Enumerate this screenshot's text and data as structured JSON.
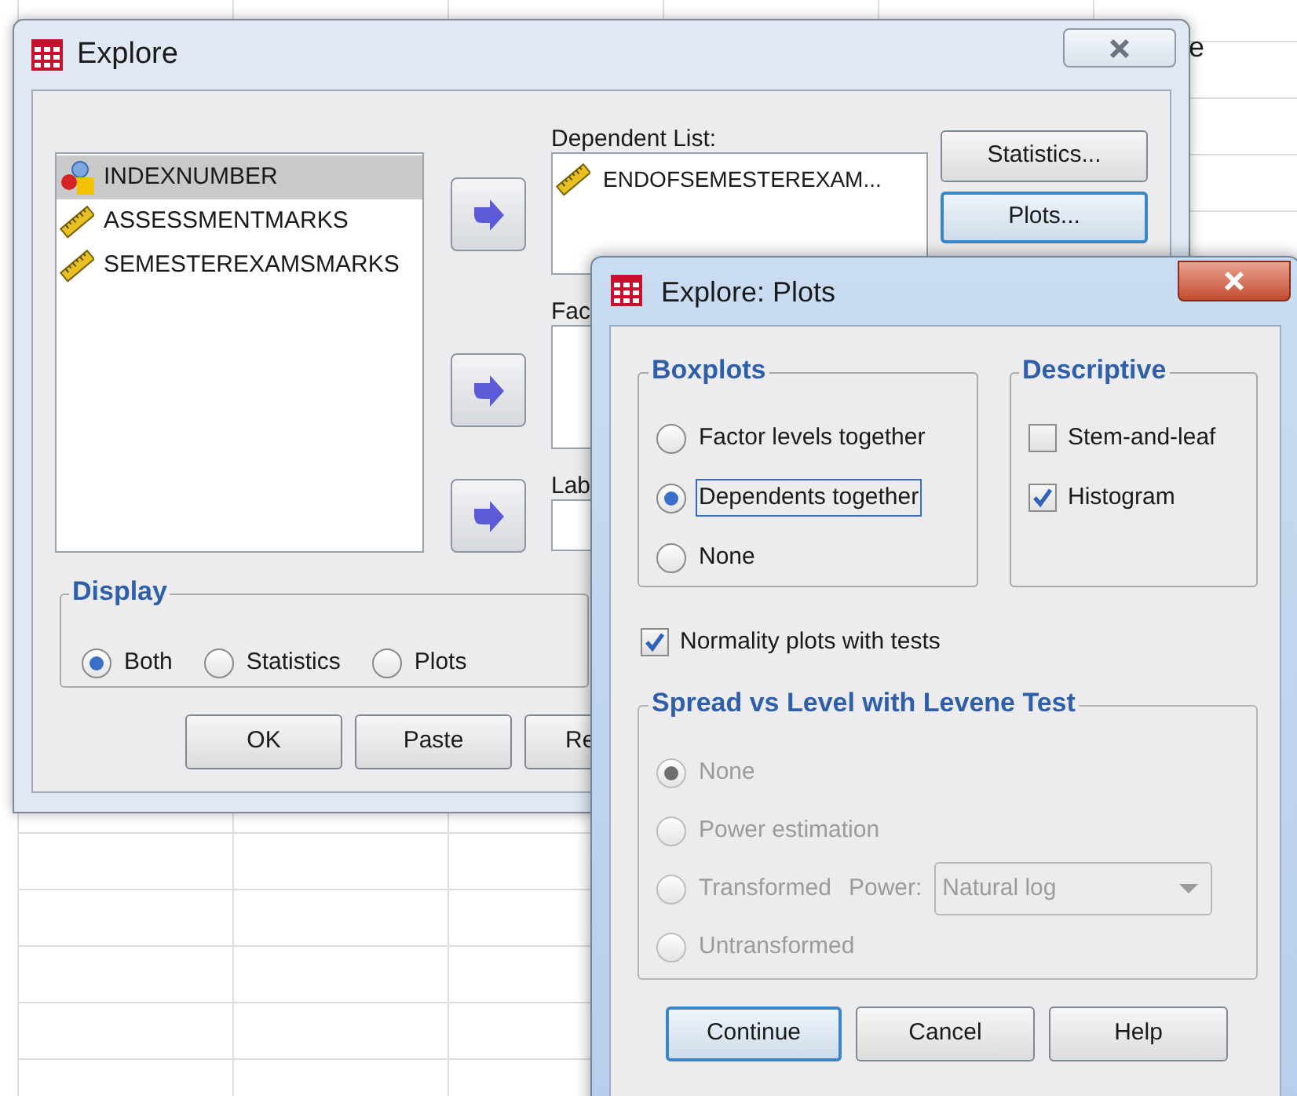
{
  "sheet": {
    "cell_fragment": "e"
  },
  "explore": {
    "title": "Explore",
    "variables": [
      {
        "name": "INDEXNUMBER",
        "kind": "nominal",
        "selected": true
      },
      {
        "name": "ASSESSMENTMARKS",
        "kind": "scale",
        "selected": false
      },
      {
        "name": "SEMESTEREXAMSMARKS",
        "kind": "scale",
        "selected": false
      }
    ],
    "dependent_list": {
      "label": "Dependent List:",
      "items": [
        {
          "name": "ENDOFSEMESTEREXAM...",
          "kind": "scale"
        }
      ]
    },
    "factor_list": {
      "label": "Fac"
    },
    "label_cases": {
      "label": "Lab"
    },
    "side_buttons": [
      {
        "label": "Statistics...",
        "focused": false
      },
      {
        "label": "Plots...",
        "focused": true
      }
    ],
    "display": {
      "title": "Display",
      "options": [
        {
          "label": "Both",
          "selected": true
        },
        {
          "label": "Statistics",
          "selected": false
        },
        {
          "label": "Plots",
          "selected": false
        }
      ]
    },
    "buttons": [
      {
        "label": "OK",
        "clipped": false
      },
      {
        "label": "Paste",
        "clipped": false
      },
      {
        "label": "Re",
        "clipped": true
      }
    ]
  },
  "plots": {
    "title": "Explore: Plots",
    "boxplots": {
      "title": "Boxplots",
      "options": [
        {
          "label": "Factor levels together",
          "selected": false,
          "focused": false
        },
        {
          "label": "Dependents together",
          "selected": true,
          "focused": true
        },
        {
          "label": "None",
          "selected": false,
          "focused": false
        }
      ]
    },
    "descriptive": {
      "title": "Descriptive",
      "options": [
        {
          "label": "Stem-and-leaf",
          "checked": false
        },
        {
          "label": "Histogram",
          "checked": true
        }
      ]
    },
    "normality": {
      "label": "Normality plots with tests",
      "checked": true
    },
    "spread": {
      "title": "Spread vs Level with Levene Test",
      "disabled": true,
      "options": [
        {
          "label": "None",
          "selected": true
        },
        {
          "label": "Power estimation",
          "selected": false
        },
        {
          "label": "Transformed",
          "selected": false
        },
        {
          "label": "Untransformed",
          "selected": false
        }
      ],
      "power": {
        "label": "Power:",
        "value": "Natural log"
      }
    },
    "buttons": [
      {
        "label": "Continue",
        "default": true
      },
      {
        "label": "Cancel",
        "default": false
      },
      {
        "label": "Help",
        "default": false
      }
    ]
  }
}
